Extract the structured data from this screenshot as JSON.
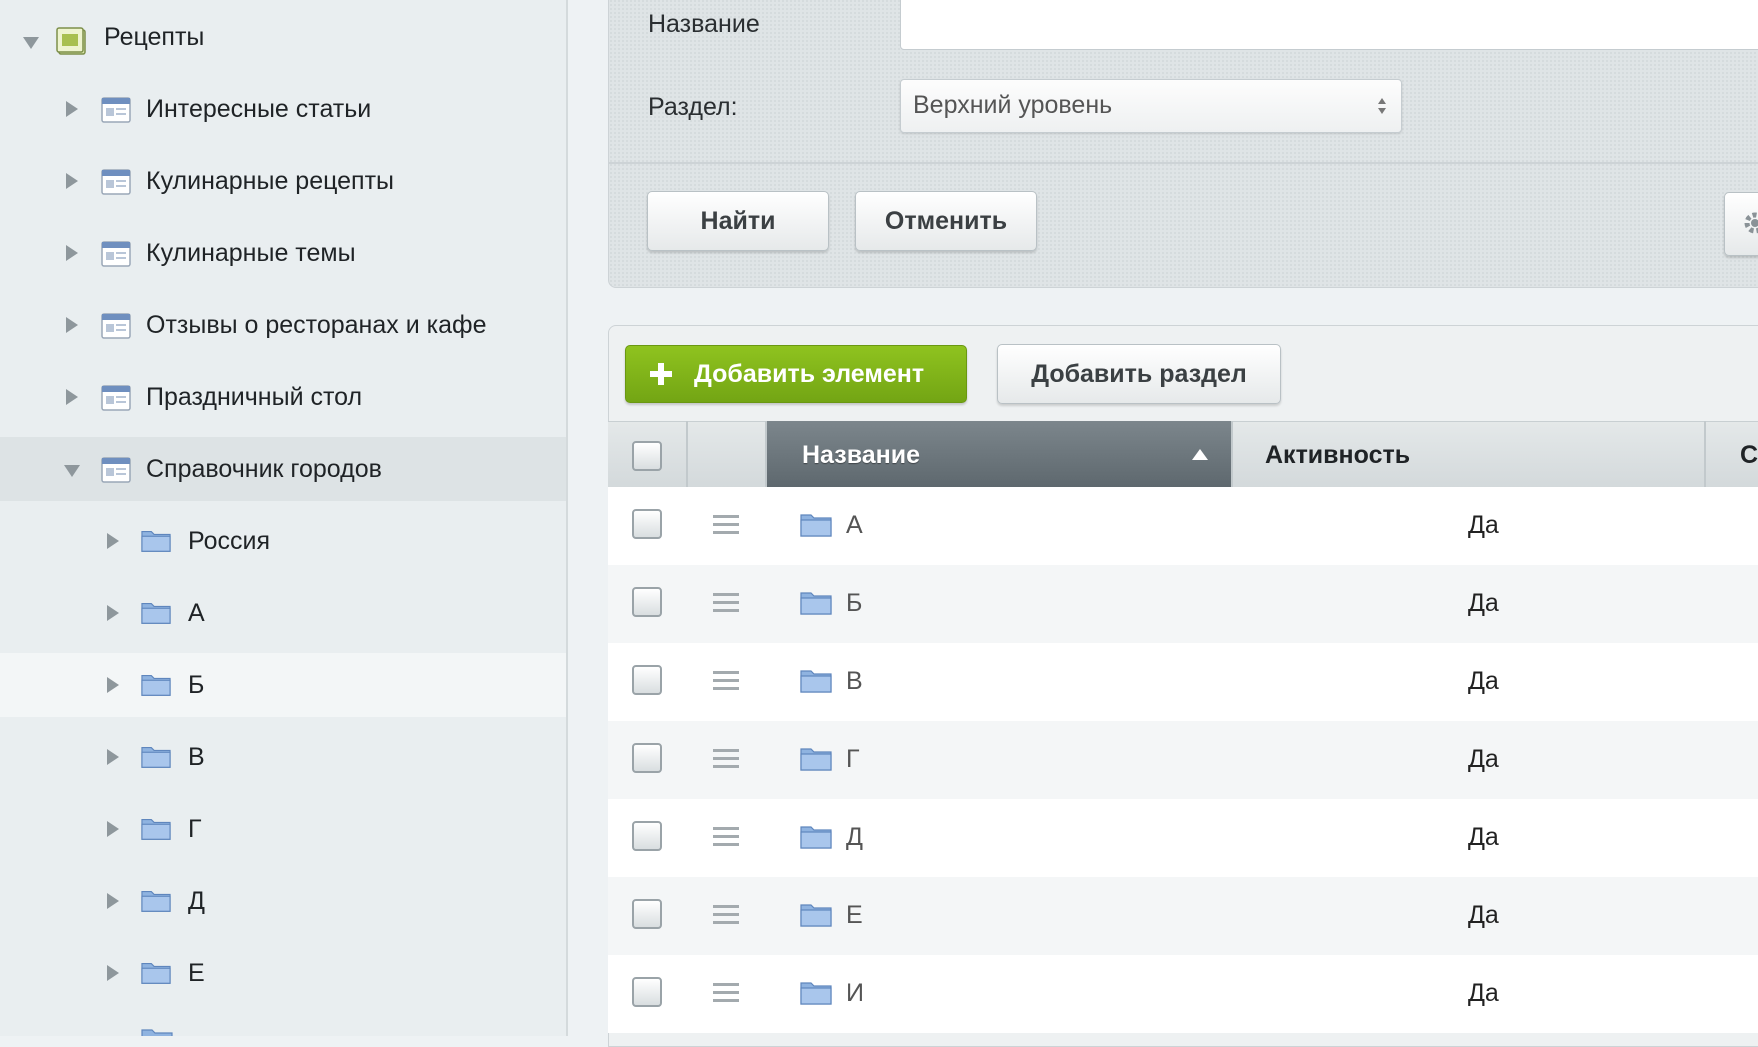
{
  "sidebar": {
    "items": [
      {
        "label": "Рецепты",
        "icon": "iblock-type-icon",
        "expanded": true
      },
      {
        "label": "Интересные статьи",
        "icon": "iblock-icon",
        "expanded": false
      },
      {
        "label": "Кулинарные рецепты",
        "icon": "iblock-icon",
        "expanded": false
      },
      {
        "label": "Кулинарные темы",
        "icon": "iblock-icon",
        "expanded": false
      },
      {
        "label": "Отзывы о ресторанах и кафе",
        "icon": "iblock-icon",
        "expanded": false
      },
      {
        "label": "Праздничный стол",
        "icon": "iblock-icon",
        "expanded": false
      },
      {
        "label": "Справочник городов",
        "icon": "iblock-icon",
        "expanded": true,
        "selected": true
      },
      {
        "label": "Россия",
        "icon": "folder-icon",
        "expanded": false
      },
      {
        "label": "А",
        "icon": "folder-icon",
        "expanded": false
      },
      {
        "label": "Б",
        "icon": "folder-icon",
        "expanded": false,
        "hover": true
      },
      {
        "label": "В",
        "icon": "folder-icon",
        "expanded": false
      },
      {
        "label": "Г",
        "icon": "folder-icon",
        "expanded": false
      },
      {
        "label": "Д",
        "icon": "folder-icon",
        "expanded": false
      },
      {
        "label": "Е",
        "icon": "folder-icon",
        "expanded": false
      }
    ]
  },
  "filter": {
    "name_label": "Название",
    "name_value": "",
    "section_label": "Раздел:",
    "section_value": "Верхний уровень",
    "find_button": "Найти",
    "cancel_button": "Отменить"
  },
  "toolbar": {
    "add_element": "Добавить элемент",
    "add_section": "Добавить раздел"
  },
  "grid": {
    "columns": [
      "Название",
      "Активность",
      "С"
    ],
    "sorted_column": "Название",
    "sort_direction": "asc",
    "rows": [
      {
        "name": "А",
        "active": "Да"
      },
      {
        "name": "Б",
        "active": "Да"
      },
      {
        "name": "В",
        "active": "Да"
      },
      {
        "name": "Г",
        "active": "Да"
      },
      {
        "name": "Д",
        "active": "Да"
      },
      {
        "name": "Е",
        "active": "Да"
      },
      {
        "name": "И",
        "active": "Да"
      }
    ]
  },
  "colors": {
    "accent_green": "#7cb518",
    "sorted_header": "#6b757b"
  }
}
